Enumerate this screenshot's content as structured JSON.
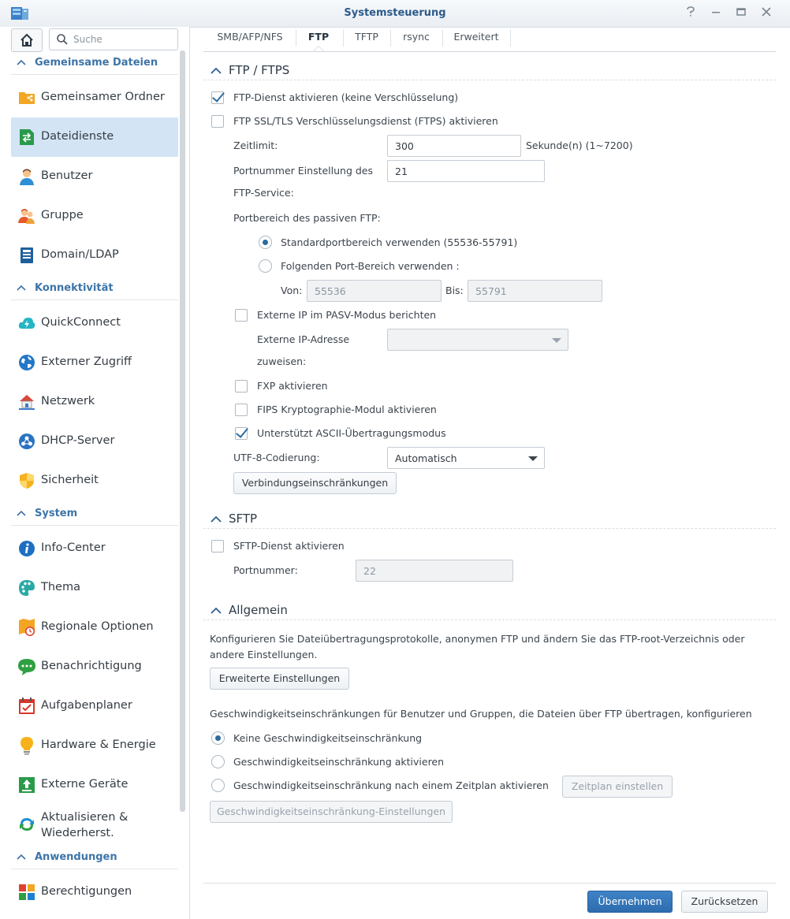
{
  "window": {
    "title": "Systemsteuerung"
  },
  "sidebar": {
    "search_placeholder": "Suche",
    "groups": [
      {
        "label": "Gemeinsame Dateien"
      },
      {
        "label": "Konnektivität"
      },
      {
        "label": "System"
      },
      {
        "label": "Anwendungen"
      }
    ],
    "items": [
      {
        "label": "Gemeinsamer Ordner",
        "icon": "shared-folder-icon"
      },
      {
        "label": "Dateidienste",
        "icon": "file-services-icon",
        "selected": true
      },
      {
        "label": "Benutzer",
        "icon": "user-icon"
      },
      {
        "label": "Gruppe",
        "icon": "group-icon"
      },
      {
        "label": "Domain/LDAP",
        "icon": "domain-icon"
      },
      {
        "label": "QuickConnect",
        "icon": "quickconnect-icon"
      },
      {
        "label": "Externer Zugriff",
        "icon": "globe-icon"
      },
      {
        "label": "Netzwerk",
        "icon": "network-icon"
      },
      {
        "label": "DHCP-Server",
        "icon": "dhcp-icon"
      },
      {
        "label": "Sicherheit",
        "icon": "shield-icon"
      },
      {
        "label": "Info-Center",
        "icon": "info-icon"
      },
      {
        "label": "Thema",
        "icon": "palette-icon"
      },
      {
        "label": "Regionale Optionen",
        "icon": "regional-icon"
      },
      {
        "label": "Benachrichtigung",
        "icon": "chat-icon"
      },
      {
        "label": "Aufgabenplaner",
        "icon": "calendar-icon"
      },
      {
        "label": "Hardware & Energie",
        "icon": "bulb-icon"
      },
      {
        "label": "Externe Geräte",
        "icon": "external-device-icon"
      },
      {
        "label": "Aktualisieren & Wiederherst.",
        "icon": "refresh-icon"
      },
      {
        "label": "Berechtigungen",
        "icon": "permissions-icon"
      }
    ]
  },
  "tabs": [
    {
      "label": "SMB/AFP/NFS"
    },
    {
      "label": "FTP",
      "active": true
    },
    {
      "label": "TFTP"
    },
    {
      "label": "rsync"
    },
    {
      "label": "Erweitert"
    }
  ],
  "ftp": {
    "section_title": "FTP / FTPS",
    "enable_ftp": {
      "label": "FTP-Dienst aktivieren (keine Verschlüsselung)",
      "checked": true
    },
    "enable_ftps": {
      "label": "FTP SSL/TLS Verschlüsselungsdienst (FTPS) aktivieren",
      "checked": false
    },
    "timeout_label": "Zeitlimit:",
    "timeout_value": "300",
    "timeout_unit": "Sekunde(n) (1~7200)",
    "port_label_1": "Portnummer Einstellung des",
    "port_label_2": "FTP-Service:",
    "port_value": "21",
    "passive_label": "Portbereich des passiven FTP:",
    "passive_default": {
      "label": "Standardportbereich verwenden (55536-55791)",
      "checked": true
    },
    "passive_custom": {
      "label": "Folgenden Port-Bereich verwenden :",
      "checked": false
    },
    "from_label": "Von:",
    "from_value": "55536",
    "to_label": "Bis:",
    "to_value": "55791",
    "external_ip": {
      "label": "Externe IP im PASV-Modus berichten",
      "checked": false
    },
    "external_ip_label_1": "Externe IP-Adresse",
    "external_ip_label_2": "zuweisen:",
    "external_ip_value": "",
    "fxp": {
      "label": "FXP aktivieren",
      "checked": false
    },
    "fips": {
      "label": "FIPS Kryptographie-Modul aktivieren",
      "checked": false
    },
    "ascii": {
      "label": "Unterstützt ASCII-Übertragungsmodus",
      "checked": true
    },
    "utf8_label": "UTF-8-Codierung:",
    "utf8_value": "Automatisch",
    "connections_button": "Verbindungseinschränkungen"
  },
  "sftp": {
    "section_title": "SFTP",
    "enable": {
      "label": "SFTP-Dienst aktivieren",
      "checked": false
    },
    "port_label": "Portnummer:",
    "port_value": "22"
  },
  "general": {
    "section_title": "Allgemein",
    "description": "Konfigurieren Sie Dateiübertragungsprotokolle, anonymen FTP und ändern Sie das FTP-root-Verzeichnis oder andere Einstellungen.",
    "advanced_button": "Erweiterte Einstellungen",
    "speed_description": "Geschwindigkeitseinschränkungen für Benutzer und Gruppen, die Dateien über FTP übertragen, konfigurieren",
    "speed_none": {
      "label": "Keine Geschwindigkeitseinschränkung",
      "checked": true
    },
    "speed_enable": {
      "label": "Geschwindigkeitseinschränkung aktivieren",
      "checked": false
    },
    "speed_schedule": {
      "label": "Geschwindigkeitseinschränkung nach einem Zeitplan aktivieren",
      "checked": false
    },
    "schedule_button": "Zeitplan einstellen",
    "speed_settings_button": "Geschwindigkeitseinschränkung-Einstellungen"
  },
  "footer": {
    "apply_button": "Übernehmen",
    "reset_button": "Zurücksetzen"
  },
  "colors": {
    "accent": "#2d6aa0",
    "group_label": "#3d74a8",
    "selected_bg": "#d3e4f5"
  }
}
